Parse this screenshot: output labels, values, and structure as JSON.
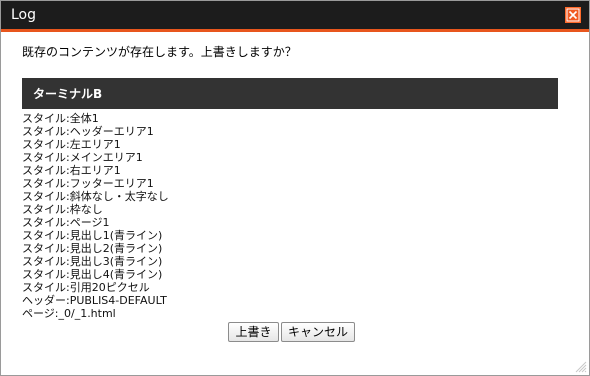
{
  "window": {
    "title": "Log",
    "close_icon": "close-icon"
  },
  "dialog": {
    "message": "既存のコンテンツが存在します。上書きしますか？",
    "section_title": "ターミナルB",
    "items": [
      "スタイル:全体1",
      "スタイル:ヘッダーエリア1",
      "スタイル:左エリア1",
      "スタイル:メインエリア1",
      "スタイル:右エリア1",
      "スタイル:フッターエリア1",
      "スタイル:斜体なし・太字なし",
      "スタイル:枠なし",
      "スタイル:ページ1",
      "スタイル:見出し1(青ライン)",
      "スタイル:見出し2(青ライン)",
      "スタイル:見出し3(青ライン)",
      "スタイル:見出し4(青ライン)",
      "スタイル:引用20ピクセル",
      "ヘッダー:PUBLIS4-DEFAULT",
      "ページ:_0/_1.html"
    ],
    "buttons": {
      "overwrite": "上書き",
      "cancel": "キャンセル"
    }
  },
  "colors": {
    "titlebar": "#1c1c1c",
    "accent": "#e8561d",
    "section_header": "#333333"
  }
}
